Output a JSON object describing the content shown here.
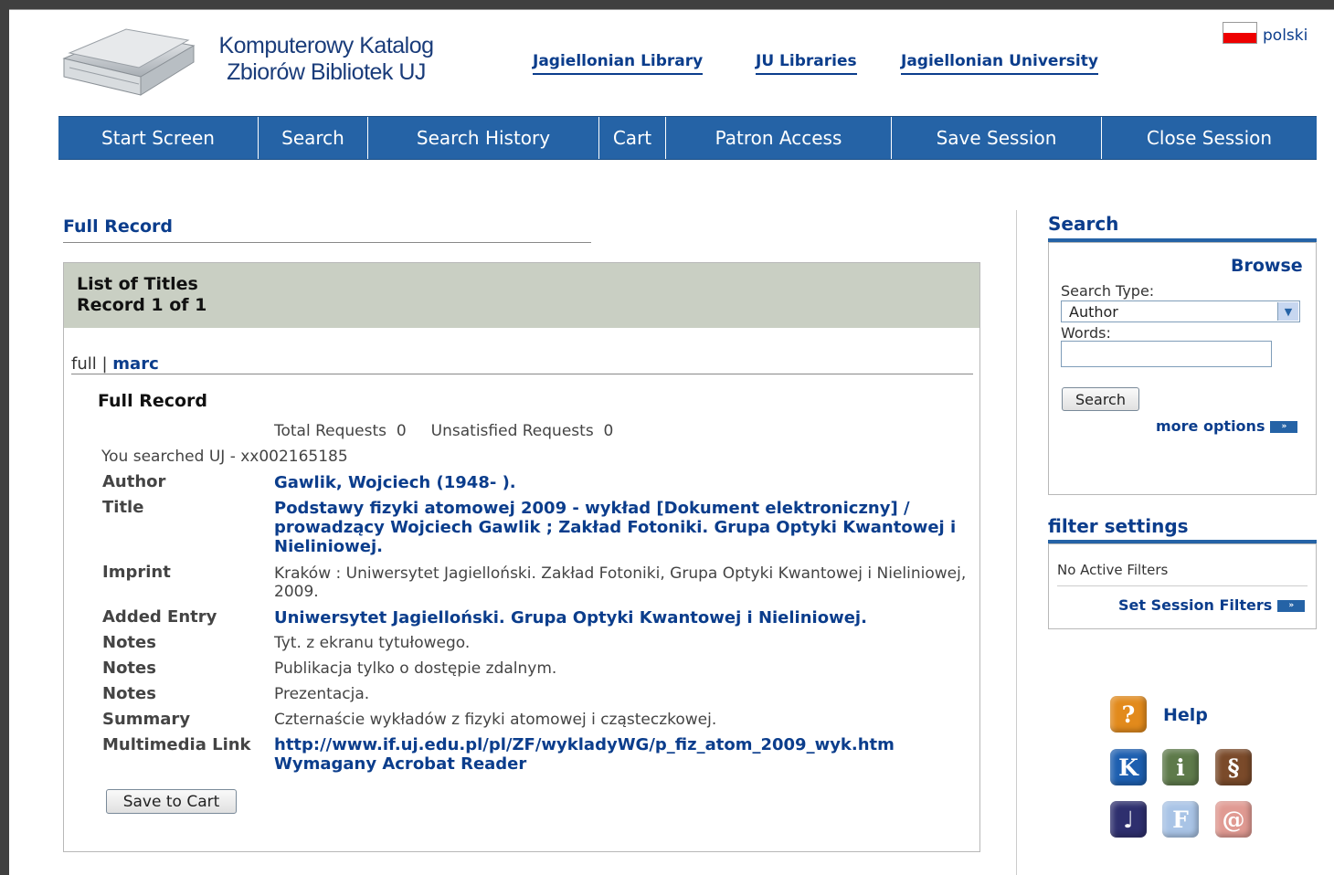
{
  "header": {
    "brand_line1": "Komputerowy Katalog",
    "brand_line2": "Zbiorów Bibliotek UJ",
    "links": [
      "Jagiellonian Library",
      "JU Libraries",
      "Jagiellonian University"
    ],
    "language": "polski"
  },
  "nav": [
    "Start Screen",
    "Search",
    "Search History",
    "Cart",
    "Patron Access",
    "Save Session",
    "Close Session"
  ],
  "main": {
    "heading": "Full Record",
    "list_title": "List of Titles",
    "record_count": "Record 1 of 1",
    "tab_full": "full",
    "tab_separator": "|",
    "tab_marc": "marc",
    "record_heading": "Full Record",
    "requests": "Total Requests  0     Unsatisfied Requests  0",
    "searched": "You searched UJ - xx002165185",
    "fields": [
      {
        "label": "Author",
        "value": "Gawlik, Wojciech (1948- ).",
        "link": true
      },
      {
        "label": "Title",
        "value": "Podstawy fizyki atomowej 2009 - wykład [Dokument elektroniczny] / prowadzący Wojciech Gawlik ; Zakład Fotoniki. Grupa Optyki Kwantowej i Nieliniowej.",
        "link": true
      },
      {
        "label": "Imprint",
        "value": "Kraków : Uniwersytet Jagielloński. Zakład Fotoniki, Grupa Optyki Kwantowej i Nieliniowej, 2009.",
        "link": false
      },
      {
        "label": "Added Entry",
        "value": "Uniwersytet Jagielloński. Grupa Optyki Kwantowej i Nieliniowej.",
        "link": true
      },
      {
        "label": "Notes",
        "value": "Tyt. z ekranu tytułowego.",
        "link": false
      },
      {
        "label": "Notes",
        "value": "Publikacja tylko o dostępie zdalnym.",
        "link": false
      },
      {
        "label": "Notes",
        "value": "Prezentacja.",
        "link": false
      },
      {
        "label": "Summary",
        "value": "Czternaście wykładów z fizyki atomowej i cząsteczkowej.",
        "link": false
      },
      {
        "label": "Multimedia Link",
        "value": "http://www.if.uj.edu.pl/pl/ZF/wykladyWG/p_fiz_atom_2009_wyk.htm Wymagany Acrobat Reader",
        "link": true
      }
    ],
    "save_button": "Save to Cart"
  },
  "sidebar": {
    "search_heading": "Search",
    "browse": "Browse",
    "search_type_label": "Search Type:",
    "search_type_value": "Author",
    "words_label": "Words:",
    "words_value": "",
    "search_button": "Search",
    "more_options": "more options",
    "arrow_glyph": "»",
    "filter_heading": "filter settings",
    "no_filters": "No Active Filters",
    "set_filters": "Set Session Filters",
    "help": "Help",
    "icon_glyphs": {
      "help": "?",
      "k": "K",
      "info": "i",
      "section": "§",
      "clock": "♩",
      "f": "F",
      "at": "@"
    }
  },
  "colors": {
    "nav": "#2563a6",
    "link": "#0b3d8c",
    "panel_head": "#c9cfc3"
  }
}
